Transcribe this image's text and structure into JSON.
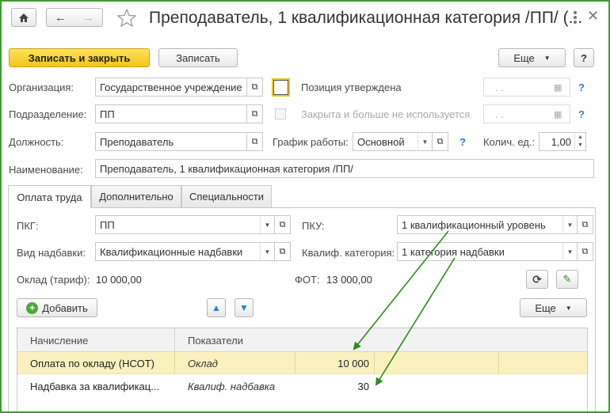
{
  "window": {
    "title": "Преподаватель, 1 квалификационная категория /ПП/ (...",
    "more_icon": "more-vertical-icon",
    "close_icon": "close-icon"
  },
  "toolbar": {
    "save_close_label": "Записать и закрыть",
    "save_label": "Записать",
    "more_label": "Еще",
    "help_label": "?"
  },
  "form": {
    "org_label": "Организация:",
    "org_value": "Государственное учреждение",
    "position_approved_label": "Позиция утверждена",
    "position_approved_date": ". .",
    "subdivision_label": "Подразделение:",
    "subdivision_value": "ПП",
    "closed_label": "Закрыта и больше не используется",
    "closed_date": ". .",
    "post_label": "Должность:",
    "post_value": "Преподаватель",
    "schedule_label": "График работы:",
    "schedule_value": "Основной",
    "units_label": "Колич. ед.:",
    "units_value": "1,00",
    "name_label": "Наименование:",
    "name_value": "Преподаватель, 1 квалификационная категория /ПП/",
    "help_mark": "?"
  },
  "tabs": [
    {
      "label": "Оплата труда"
    },
    {
      "label": "Дополнительно"
    },
    {
      "label": "Специальности"
    }
  ],
  "payment": {
    "pkg_label": "ПКГ:",
    "pkg_value": "ПП",
    "pku_label": "ПКУ:",
    "pku_value": "1 квалификационный уровень",
    "bonus_type_label": "Вид надбавки:",
    "bonus_type_value": "Квалификационные надбавки",
    "qual_cat_label": "Квалиф. категория:",
    "qual_cat_value": "1 категория надбавки",
    "salary_label": "Оклад (тариф):",
    "salary_value": "10 000,00",
    "fot_label": "ФОТ:",
    "fot_value": "13 000,00",
    "add_label": "Добавить",
    "more_label": "Еще"
  },
  "table": {
    "headers": [
      "Начисление",
      "Показатели"
    ],
    "rows": [
      {
        "accrual": "Оплата по окладу (НСОТ)",
        "indicator": "Оклад",
        "value": "10 000"
      },
      {
        "accrual": "Надбавка за квалификац...",
        "indicator": "Квалиф. надбавка",
        "value": "30"
      }
    ]
  },
  "colors": {
    "accent_green": "#3f9b32",
    "primary_button": "#f2c417",
    "selected_row": "#fbf1bf",
    "link_blue": "#2a7fd4"
  }
}
